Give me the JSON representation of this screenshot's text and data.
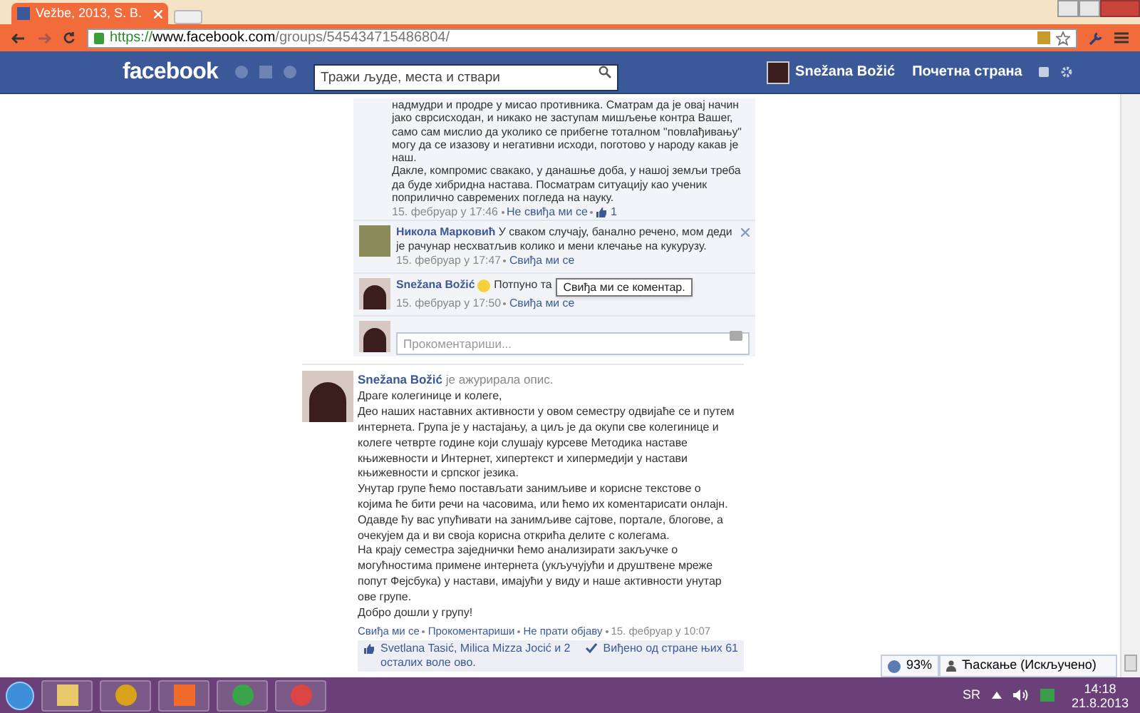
{
  "browser": {
    "tab_title": "Vežbe, 2013, S. B.",
    "url": {
      "scheme": "https://",
      "host": "www.facebook.com",
      "path": "/groups/545434715486804/"
    }
  },
  "header": {
    "logo": "facebook",
    "search": {
      "placeholder": "Тражи људе, места и ствари"
    },
    "user": "Snežana Božić",
    "home": "Почетна страна"
  },
  "previous_post": {
    "comment_tail": "надмудри и продре у мисао противника. Сматрам да је овај начин\nјако сврсисходан, и никако не заступам мишљење контра Вашег,\nсамо сам мислио да уколико се прибегне тоталном \"повлађивању\"\nмогу да се изазову и негативни исходи, поготово у народу какав је\nнаш.\nДакле, компромис свакако, у данашње доба, у нашој земљи треба\nда буде хибридна настава. Посматрам ситуацију као ученик\nпоприлично савремених погледа на науку.",
    "comment_time": "15. фебруар у 17:46",
    "comment_action": "Не свиђа ми се",
    "comment_likes": "1",
    "comments": [
      {
        "kind": "photo",
        "author": "Никола Марковић",
        "text": "У сваком случају, банално речено, мом деди је рачунар несхватљив колико и мени клечање на кукурузу.",
        "time": "15. фебруар у 17:47",
        "action": "Свиђа ми се",
        "removable": true,
        "emoticon": false
      },
      {
        "kind": "avatar",
        "author": "Snežana Božić",
        "text": "Потпуно та",
        "time": "15. фебруар у 17:50",
        "action": "Свиђа ми се",
        "removable": false,
        "emoticon": true
      }
    ],
    "tooltip": "Свиђа ми се коментар.",
    "comment_placeholder": "Прокоментариши..."
  },
  "post": {
    "author": "Snežana Božić",
    "activity": "је ажурирала опис.",
    "body": "Драге колегинице и колеге,\nДео наших наставних активности у овом семестру одвијаће се и путем интернета. Група је у настајању, а циљ је да окупи све колегинице и колеге четврте године који слушају курсеве Методика наставе књижевности и Интернет, хипертекст и хипермедији у настави књижевности и српског језика.\nУнутар групе ћемо постављати занимљиве и корисне текстове о којима ће бити речи на часовима, или ћемо их коментарисати онлајн. Одавде ћу вас упућивати на занимљиве сајтове, портале, блогове, а очекујем да и ви своја корисна открића делите с колегама.\nНа крају семестра заједнички ћемо анализирати закључке о могућностима примене интернета (укључујући и друштвене мреже попут Фејсбука) у настави, имајући у виду и наше активности унутар ове групе.\nДобро дошли у групу!",
    "actions": [
      "Свиђа ми се",
      "Прокоментариши",
      "Не прати објаву"
    ],
    "time": "15. фебруар у 10:07",
    "likes": "Svetlana Tasić, Milica Mizza Jocić и 2 осталих воле ово.",
    "seen": "Виђено од стране њих 61"
  },
  "chat": {
    "battery": "93%",
    "status": "Ћаскање (Искључено)"
  },
  "taskbar": {
    "language": "SR",
    "time": "14:18",
    "date": "21.8.2013"
  }
}
